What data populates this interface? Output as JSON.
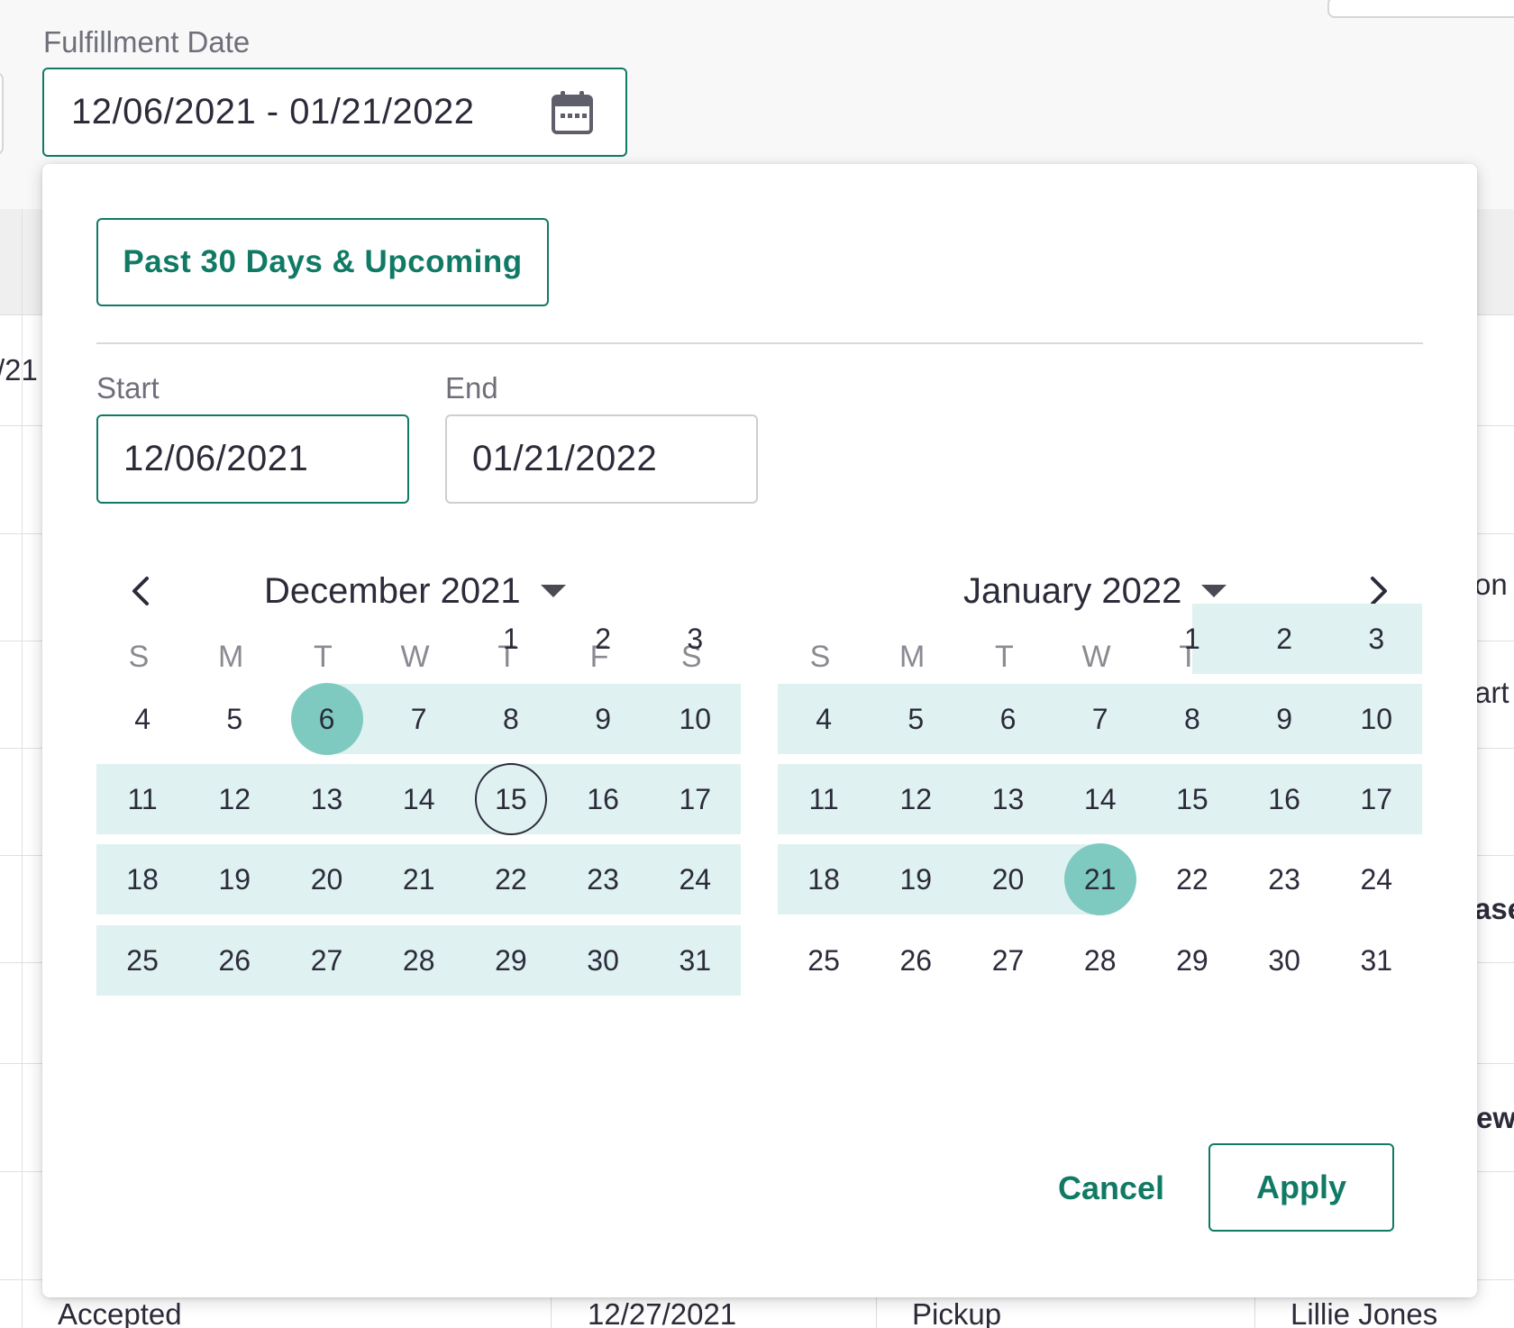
{
  "field": {
    "label": "Fulfillment Date",
    "value": "12/06/2021 - 01/21/2022",
    "icon": "calendar-icon"
  },
  "popover": {
    "preset_label": "Past 30 Days & Upcoming",
    "start_label": "Start",
    "start_value": "12/06/2021",
    "end_label": "End",
    "end_value": "01/21/2022",
    "cancel_label": "Cancel",
    "apply_label": "Apply",
    "prev_icon": "chevron-left-icon",
    "next_icon": "chevron-right-icon",
    "weekdays": [
      "S",
      "M",
      "T",
      "W",
      "T",
      "F",
      "S"
    ],
    "months": [
      {
        "title": "December 2021",
        "first_weekday": 4,
        "days": 31,
        "range_start": 6,
        "range_end": 31,
        "selected": [
          6
        ],
        "today": 15
      },
      {
        "title": "January 2022",
        "first_weekday": 4,
        "days": 31,
        "range_start": 1,
        "range_end": 21,
        "selected": [
          21
        ],
        "today": null
      }
    ],
    "colors": {
      "accent": "#117a65",
      "range_band": "#dff1f0",
      "selected": "#7fcac0"
    }
  },
  "background": {
    "row_fragments": [
      "/21",
      "on",
      "art",
      "ase",
      "ew"
    ],
    "bottom_row": [
      "Accepted",
      "12/27/2021",
      "Pickup",
      "Lillie Jones"
    ]
  }
}
